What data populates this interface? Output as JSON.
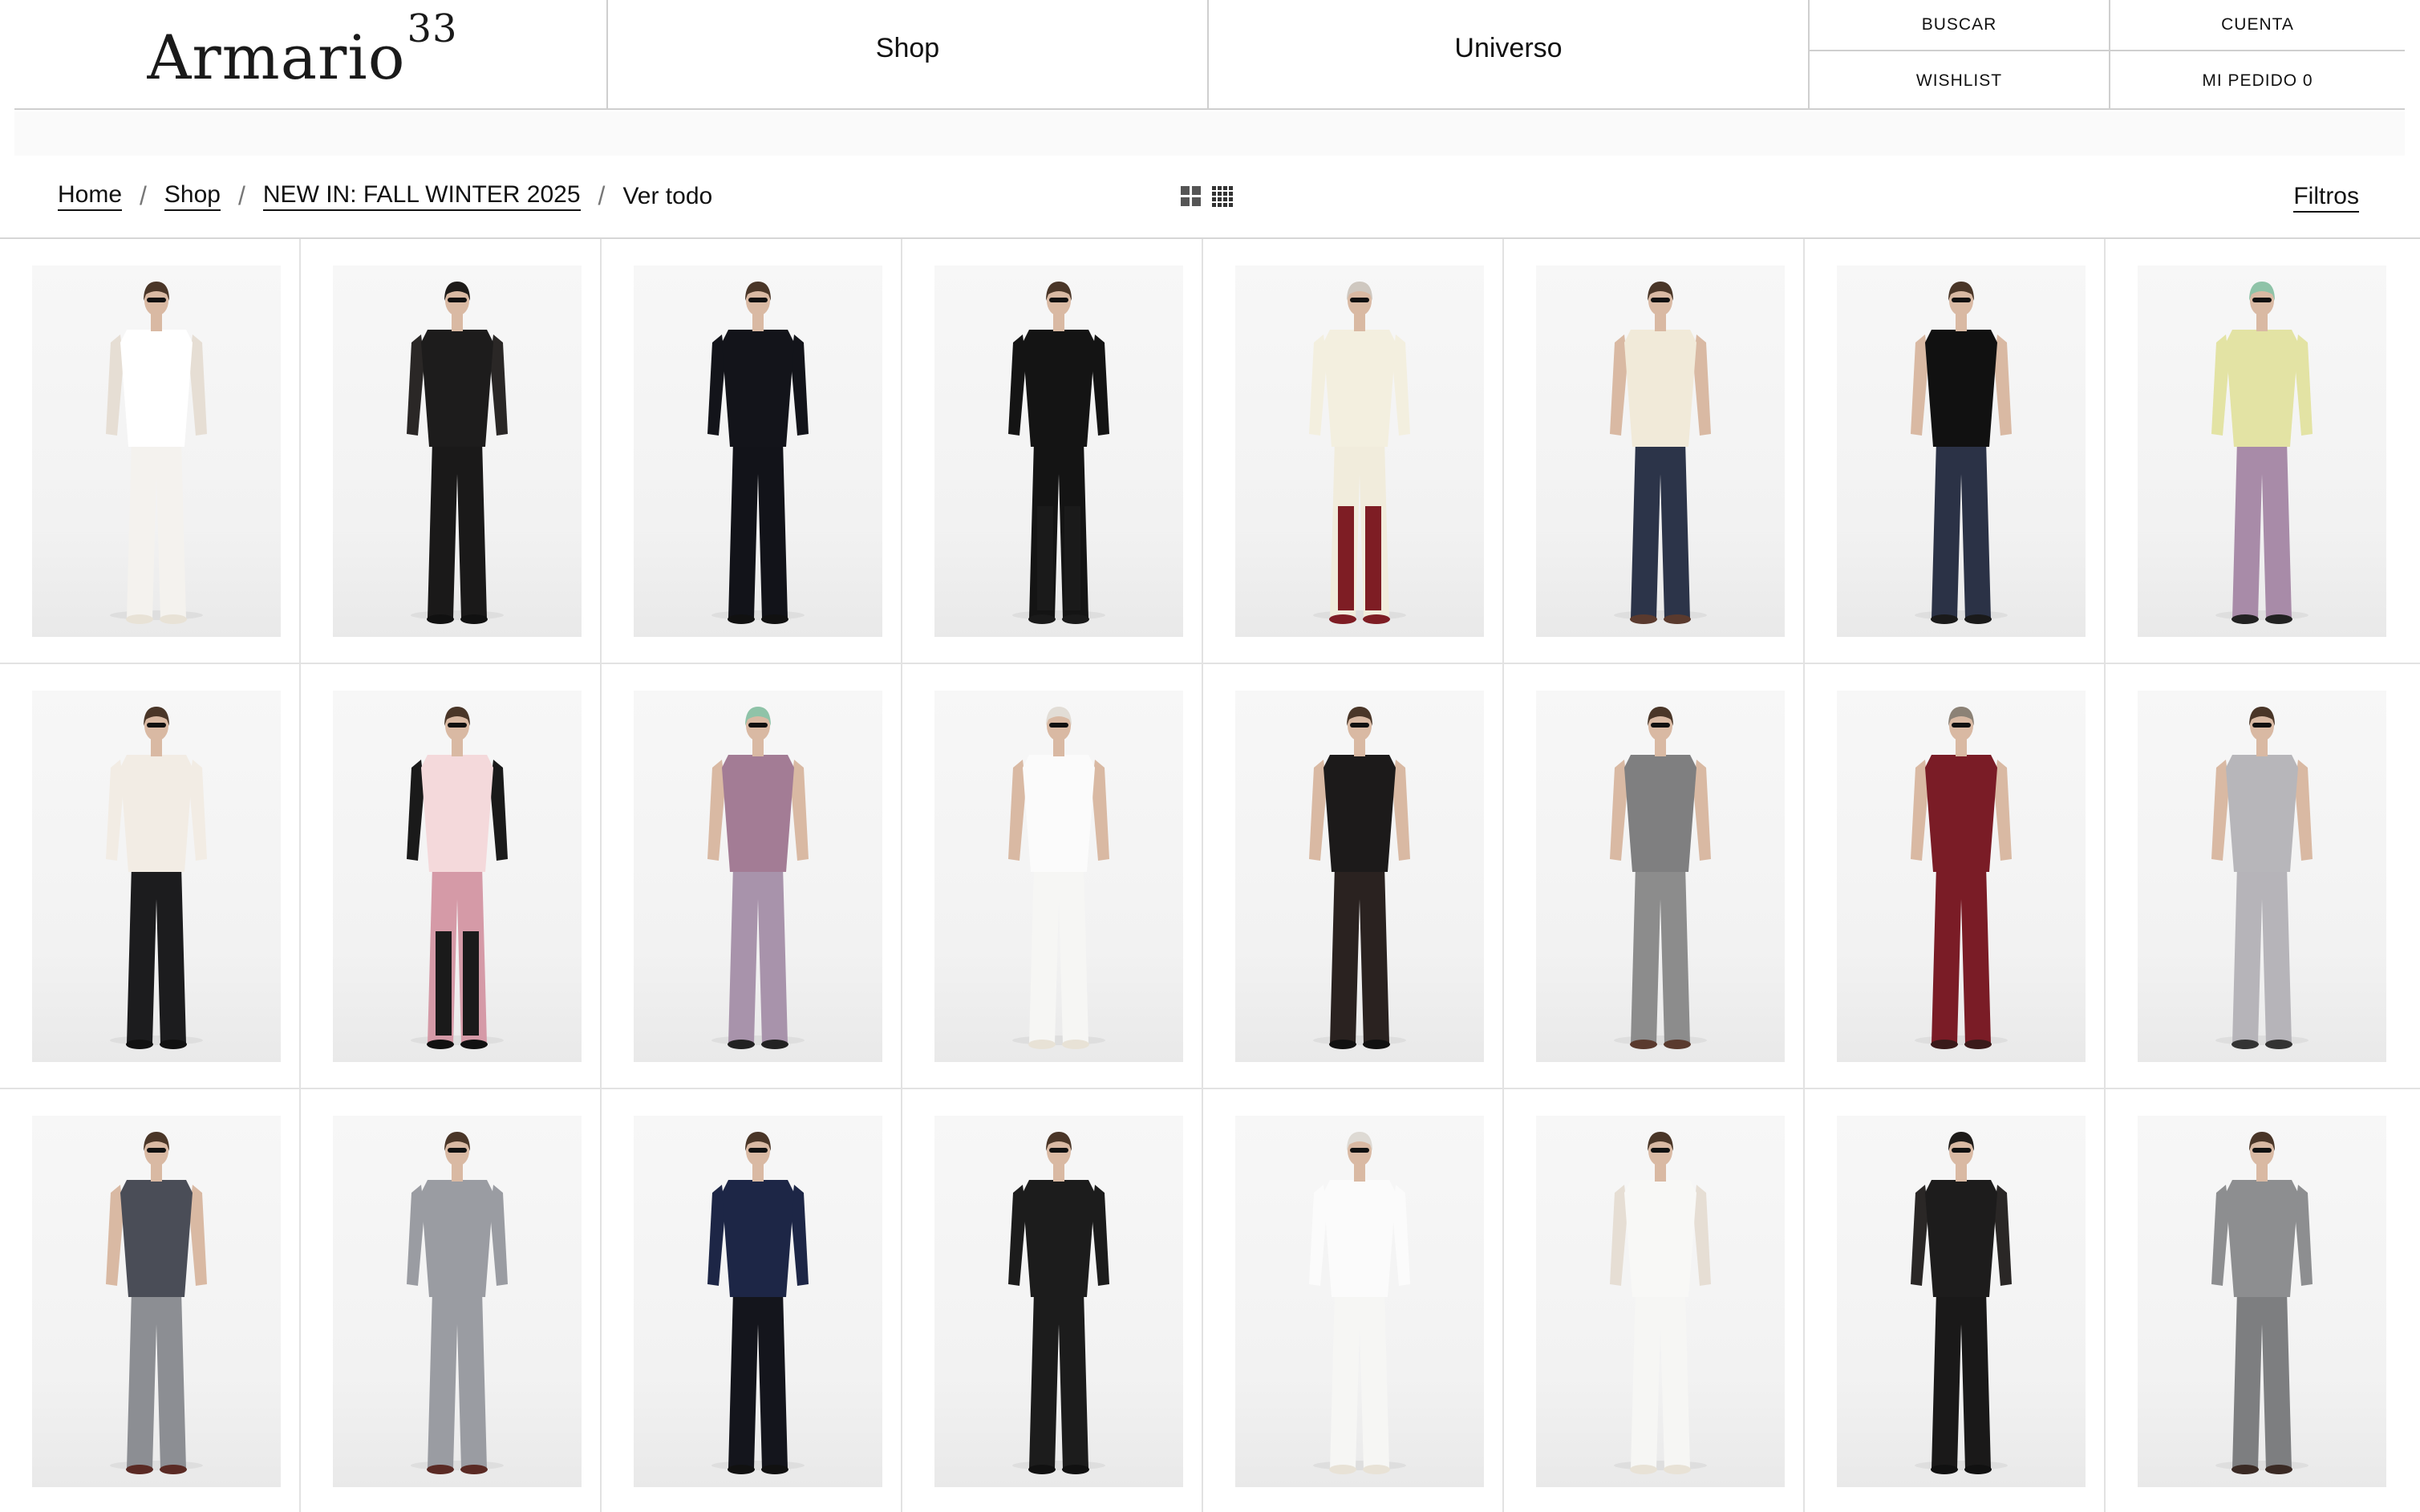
{
  "header": {
    "logo": {
      "text": "Armario",
      "sup": "33"
    },
    "nav": {
      "shop": "Shop",
      "universe": "Universo"
    },
    "utility": {
      "search": "BUSCAR",
      "account": "CUENTA",
      "wishlist": "WISHLIST",
      "order": "MI PEDIDO 0"
    }
  },
  "breadcrumb": {
    "items": [
      "Home",
      "Shop",
      "NEW IN: FALL WINTER 2025"
    ],
    "current": "Ver todo",
    "separator": "/"
  },
  "view_toggle": {
    "icons": [
      "grid-2x2-icon",
      "grid-4x4-icon"
    ]
  },
  "filters_label": "Filtros",
  "products": [
    {
      "skin": "#d9b9a3",
      "hair": "#4a3628",
      "hat": null,
      "top": "#ffffff",
      "sleeves": "#e6ded4",
      "bottom": "#f4f2ee",
      "shoes": "#e8e2d6",
      "legs": null
    },
    {
      "skin": "#d9b9a3",
      "hair": "#1e1b19",
      "hat": "#1e1b19",
      "top": "#1d1c1c",
      "sleeves": "#2a2726",
      "bottom": "#1a1919",
      "shoes": "#111111",
      "legs": null
    },
    {
      "skin": "#d9b9a3",
      "hair": "#4a3628",
      "hat": null,
      "top": "#13141a",
      "sleeves": "#13141a",
      "bottom": "#121319",
      "shoes": "#111111",
      "legs": null
    },
    {
      "skin": "#d9b9a3",
      "hair": "#4a3628",
      "hat": null,
      "top": "#141414",
      "sleeves": "#141414",
      "bottom": "#141414",
      "shoes": "#1a1a1a",
      "legs": "#1a1a1a"
    },
    {
      "skin": "#d9b9a3",
      "hair": "#cfc8c0",
      "hat": "#cfc8c0",
      "top": "#f3efdf",
      "sleeves": "#f3efdf",
      "bottom": "#f1ecdc",
      "shoes": "#7e1d24",
      "legs": "#7e1d24"
    },
    {
      "skin": "#d9b9a3",
      "hair": "#4a3628",
      "hat": null,
      "top": "#f1ead9",
      "sleeves": "#d9b9a3",
      "bottom": "#2c3449",
      "shoes": "#5a3a2e",
      "legs": null
    },
    {
      "skin": "#d9b9a3",
      "hair": "#4a3628",
      "hat": null,
      "top": "#111111",
      "sleeves": "#d9b9a3",
      "bottom": "#2b3246",
      "shoes": "#1a1a1a",
      "legs": null
    },
    {
      "skin": "#d9b9a3",
      "hair": "#4a3628",
      "hat": "#8fc3a8",
      "top": "#e3e3a4",
      "sleeves": "#e3e3a4",
      "bottom": "#a88ba8",
      "shoes": "#222222",
      "legs": null
    },
    {
      "skin": "#d9b9a3",
      "hair": "#4a3628",
      "hat": null,
      "top": "#f2ece4",
      "sleeves": "#f2ece4",
      "bottom": "#1c1c1e",
      "shoes": "#111111",
      "legs": null
    },
    {
      "skin": "#d9b9a3",
      "hair": "#4a3628",
      "hat": null,
      "top": "#f4d9db",
      "sleeves": "#1a1a1a",
      "bottom": "#d59aa7",
      "shoes": "#111111",
      "legs": "#1a1a1a"
    },
    {
      "skin": "#d9b9a3",
      "hair": "#4a3628",
      "hat": "#8fc3a8",
      "top": "#a37c95",
      "sleeves": "#d9b9a3",
      "bottom": "#a893ab",
      "shoes": "#222222",
      "legs": null
    },
    {
      "skin": "#d9b9a3",
      "hair": "#e2ddd6",
      "hat": "#e2ddd6",
      "top": "#fbfbfb",
      "sleeves": "#d9b9a3",
      "bottom": "#f6f6f4",
      "shoes": "#e8e2d6",
      "legs": null
    },
    {
      "skin": "#d9b9a3",
      "hair": "#4a3628",
      "hat": null,
      "top": "#1c1a1a",
      "sleeves": "#d9b9a3",
      "bottom": "#2a2220",
      "shoes": "#111111",
      "legs": null
    },
    {
      "skin": "#d9b9a3",
      "hair": "#4a3628",
      "hat": null,
      "top": "#7f7f80",
      "sleeves": "#d9b9a3",
      "bottom": "#8c8c8c",
      "shoes": "#5a3a2e",
      "legs": null
    },
    {
      "skin": "#d9b9a3",
      "hair": "#8c8276",
      "hat": "#8c8276",
      "top": "#7a1c26",
      "sleeves": "#d9b9a3",
      "bottom": "#7a1c26",
      "shoes": "#3a1a1a",
      "legs": null
    },
    {
      "skin": "#d9b9a3",
      "hair": "#4a3628",
      "hat": null,
      "top": "#b7b6ba",
      "sleeves": "#d9b9a3",
      "bottom": "#b6b4b9",
      "shoes": "#333333",
      "legs": null
    },
    {
      "skin": "#d9b9a3",
      "hair": "#4a3628",
      "hat": null,
      "top": "#4a4d57",
      "sleeves": "#d9b9a3",
      "bottom": "#8c8e93",
      "shoes": "#5a2a24",
      "legs": null
    },
    {
      "skin": "#d9b9a3",
      "hair": "#4a3628",
      "hat": null,
      "top": "#9a9ca2",
      "sleeves": "#9a9ca2",
      "bottom": "#9a9ca2",
      "shoes": "#5a2a24",
      "legs": null
    },
    {
      "skin": "#d9b9a3",
      "hair": "#4a3628",
      "hat": null,
      "top": "#1d2646",
      "sleeves": "#1d2646",
      "bottom": "#14151c",
      "shoes": "#111111",
      "legs": null
    },
    {
      "skin": "#d9b9a3",
      "hair": "#4a3628",
      "hat": null,
      "top": "#1c1c1c",
      "sleeves": "#1c1c1c",
      "bottom": "#1c1c1c",
      "shoes": "#111111",
      "legs": null
    },
    {
      "skin": "#d9b9a3",
      "hair": "#dedad4",
      "hat": "#dedad4",
      "top": "#fbfbfb",
      "sleeves": "#fbfbfb",
      "bottom": "#f6f6f4",
      "shoes": "#e8e2d6",
      "legs": null
    },
    {
      "skin": "#d9b9a3",
      "hair": "#4a3628",
      "hat": null,
      "top": "#f8f8f6",
      "sleeves": "#e6ded4",
      "bottom": "#f6f6f4",
      "shoes": "#e8e2d6",
      "legs": null
    },
    {
      "skin": "#d9b9a3",
      "hair": "#1e1b19",
      "hat": "#1e1b19",
      "top": "#1d1c1c",
      "sleeves": "#2a2726",
      "bottom": "#1a1919",
      "shoes": "#111111",
      "legs": null
    },
    {
      "skin": "#d9b9a3",
      "hair": "#4a3628",
      "hat": null,
      "top": "#8d8e90",
      "sleeves": "#8d8e90",
      "bottom": "#7d7e80",
      "shoes": "#3a2a24",
      "legs": null
    }
  ]
}
